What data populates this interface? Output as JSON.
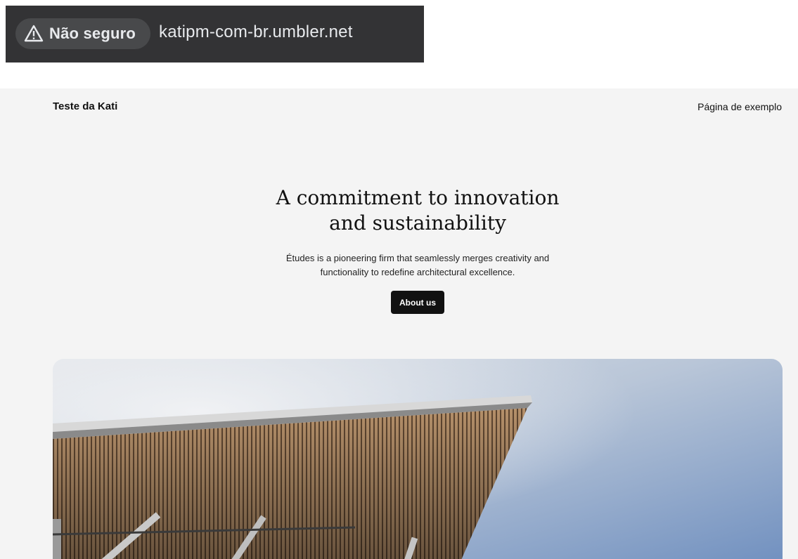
{
  "browser": {
    "security_label": "Não seguro",
    "url": "katipm-com-br.umbler.net",
    "icons": {
      "security": "warning-triangle-icon"
    }
  },
  "site": {
    "title": "Teste da Kati",
    "nav_link": "Página de exemplo"
  },
  "hero": {
    "heading_line1": "A commitment to innovation",
    "heading_line2": "and sustainability",
    "text_line1": "Études is a pioneering firm that seamlessly merges creativity and",
    "text_line2": "functionality to redefine architectural excellence.",
    "button_label": "About us"
  },
  "colors": {
    "page_background": "#f4f4f4",
    "button_background": "#111111",
    "address_bar": "#333335"
  }
}
